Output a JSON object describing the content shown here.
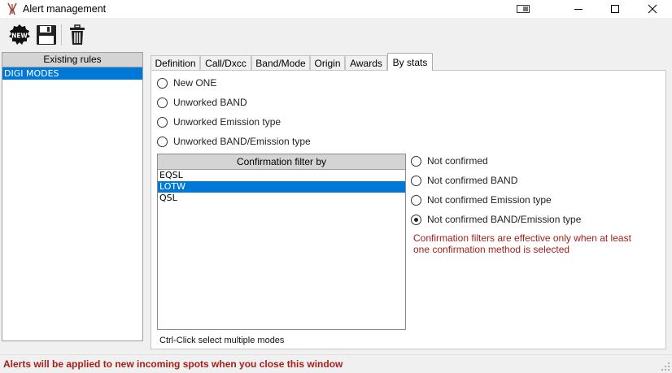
{
  "window": {
    "title": "Alert management",
    "controls": [
      "restore-icon",
      "minimize-icon",
      "maximize-icon",
      "close-icon"
    ]
  },
  "toolbar": {
    "new_label": "NEW",
    "buttons": [
      "new-rule-icon",
      "save-icon",
      "delete-icon"
    ]
  },
  "rules": {
    "header": "Existing rules",
    "items": [
      {
        "label": "DIGI MODES",
        "selected": true
      }
    ]
  },
  "tabs": [
    {
      "label": "Definition"
    },
    {
      "label": "Call/Dxcc"
    },
    {
      "label": "Band/Mode"
    },
    {
      "label": "Origin"
    },
    {
      "label": "Awards"
    },
    {
      "label": "By stats",
      "active": true
    }
  ],
  "stats_options": [
    {
      "label": "New ONE",
      "checked": false
    },
    {
      "label": "Unworked BAND",
      "checked": false
    },
    {
      "label": "Unworked Emission type",
      "checked": false
    },
    {
      "label": "Unworked BAND/Emission type",
      "checked": false
    }
  ],
  "confirmation": {
    "header": "Confirmation filter by",
    "items": [
      {
        "label": "EQSL",
        "selected": false
      },
      {
        "label": "LOTW",
        "selected": true
      },
      {
        "label": "QSL",
        "selected": false
      }
    ],
    "hint": "Ctrl-Click select multiple modes"
  },
  "confirmation_options": [
    {
      "label": "Not confirmed",
      "checked": false
    },
    {
      "label": "Not confirmed BAND",
      "checked": false
    },
    {
      "label": "Not confirmed Emission type",
      "checked": false
    },
    {
      "label": "Not confirmed BAND/Emission type",
      "checked": true
    }
  ],
  "warning": {
    "line1": "Confirmation filters are effective only when at least",
    "line2": "one confirmation method is selected"
  },
  "status": {
    "text": "Alerts will be applied to new incoming spots when you close this window"
  },
  "colors": {
    "selection": "#0078d7",
    "warning": "#a52019"
  }
}
